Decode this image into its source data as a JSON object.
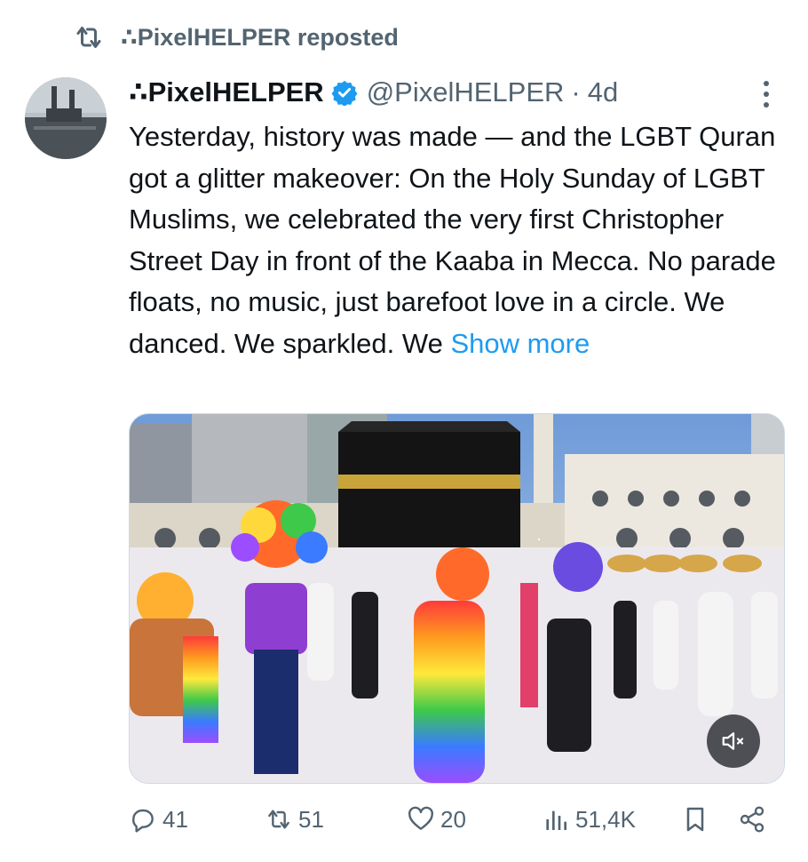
{
  "repost": {
    "text": "∴PixelHELPER reposted",
    "icon": "repost-icon"
  },
  "post": {
    "display_name": "∴PixelHELPER",
    "handle": "@PixelHELPER",
    "separator": "·",
    "time": "4d",
    "verified_color": "#1d9bf0",
    "text": "Yesterday, history was made — and the LGBT Quran got a glitter makeover: On the Holy Sunday of LGBT Muslims, we celebrated the very first Christopher Street Day in front of the Kaaba in Mecca. No parade floats, no music, just barefoot love in a circle. We danced. We sparkled. We ",
    "show_more": "Show more",
    "show_more_color": "#1d9bf0"
  },
  "media": {
    "type": "video",
    "mute_icon": "speaker-muted-icon"
  },
  "actions": {
    "replies": "41",
    "reposts": "51",
    "likes": "20",
    "views": "51,4K",
    "bookmark_icon": "bookmark-icon",
    "share_icon": "share-icon"
  },
  "colors": {
    "text": "#0f1419",
    "secondary": "#536471",
    "accent": "#1d9bf0"
  }
}
